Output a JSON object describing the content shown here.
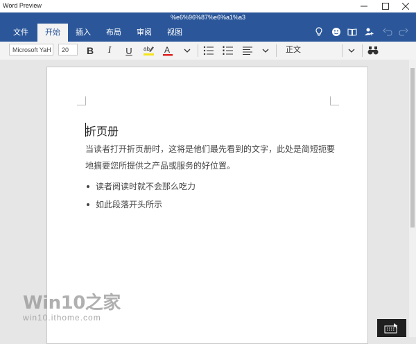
{
  "window": {
    "app_title": "Word Preview"
  },
  "ribbon": {
    "document_title": "%e6%96%87%e6%a1%a3",
    "tabs": [
      {
        "label": "文件"
      },
      {
        "label": "开始",
        "active": true
      },
      {
        "label": "插入"
      },
      {
        "label": "布局"
      },
      {
        "label": "审阅"
      },
      {
        "label": "视图"
      }
    ],
    "right_icons": [
      "lightbulb-icon",
      "smiley-icon",
      "book-icon",
      "add-person-icon",
      "undo-icon",
      "redo-icon"
    ]
  },
  "toolbar": {
    "font_name": "Microsoft YaH",
    "font_size": "20",
    "bold": "B",
    "italic": "I",
    "underline": "U",
    "font_color_glyph": "A",
    "highlight_color": "#f5e31a",
    "font_color": "#e02020",
    "style": "正文"
  },
  "document": {
    "heading": "折页册",
    "paragraph": "当读者打开折页册时，这将是他们最先看到的文字，此处是简短扼要地摘要您所提供之产品或服务的好位置。",
    "bullets": [
      "读者阅读时就不会那么吃力",
      "如此段落开头所示"
    ]
  },
  "watermark": {
    "main": "Win10之家",
    "sub": "win10.ithome.com"
  },
  "colors": {
    "accent": "#2b579a",
    "toolbar_bg": "#f3f3f3",
    "canvas_bg": "#e6e6e6"
  }
}
